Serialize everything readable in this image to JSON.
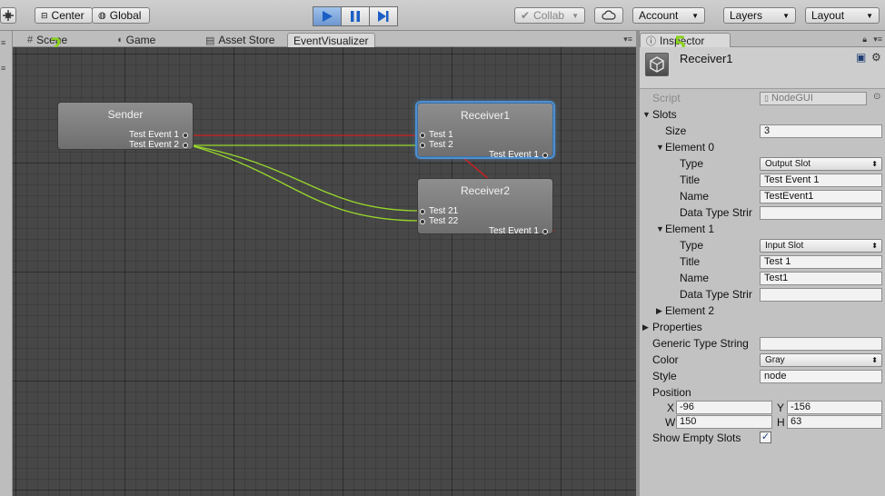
{
  "toolbar": {
    "center_label": "Center",
    "global_label": "Global",
    "collab_label": "Collab",
    "account_label": "Account",
    "layers_label": "Layers",
    "layout_label": "Layout"
  },
  "tabs": [
    {
      "label": "Scene",
      "icon": "grid-icon"
    },
    {
      "label": "Game",
      "icon": "pacman-icon"
    },
    {
      "label": "Asset Store",
      "icon": "store-icon"
    },
    {
      "label": "EventVisualizer",
      "icon": ""
    }
  ],
  "inspector_tab": {
    "label": "Inspector",
    "icon": "info-icon"
  },
  "markers": {
    "scene": "2",
    "inspector": "5"
  },
  "nodes": [
    {
      "title": "Sender",
      "inputs": [],
      "outputs": [
        "Test Event 1",
        "Test Event 2"
      ]
    },
    {
      "title": "Receiver1",
      "inputs": [
        "Test 1",
        "Test 2"
      ],
      "outputs": [
        "Test Event 1"
      ],
      "selected": true
    },
    {
      "title": "Receiver2",
      "inputs": [
        "Test 21",
        "Test 22"
      ],
      "outputs": [
        "Test Event 1"
      ]
    }
  ],
  "wire_colors": {
    "red": "#d21d1d",
    "green": "#97d82b"
  },
  "inspector": {
    "object_name": "Receiver1",
    "script_label": "Script",
    "script_value": "NodeGUI",
    "slots_label": "Slots",
    "size_label": "Size",
    "size_value": "3",
    "element0": {
      "label": "Element 0",
      "type_label": "Type",
      "type_value": "Output Slot",
      "title_label": "Title",
      "title_value": "Test Event 1",
      "name_label": "Name",
      "name_value": "TestEvent1",
      "dts_label": "Data Type Strir",
      "dts_value": ""
    },
    "element1": {
      "label": "Element 1",
      "type_label": "Type",
      "type_value": "Input Slot",
      "title_label": "Title",
      "title_value": "Test 1",
      "name_label": "Name",
      "name_value": "Test1",
      "dts_label": "Data Type Strir",
      "dts_value": ""
    },
    "element2_label": "Element 2",
    "properties_label": "Properties",
    "generic_label": "Generic Type String",
    "generic_value": "",
    "color_label": "Color",
    "color_value": "Gray",
    "style_label": "Style",
    "style_value": "node",
    "position_label": "Position",
    "pos_x_label": "X",
    "pos_x": "-96",
    "pos_y_label": "Y",
    "pos_y": "-156",
    "pos_w_label": "W",
    "pos_w": "150",
    "pos_h_label": "H",
    "pos_h": "63",
    "show_empty_label": "Show Empty Slots",
    "show_empty_checked": "✓"
  }
}
